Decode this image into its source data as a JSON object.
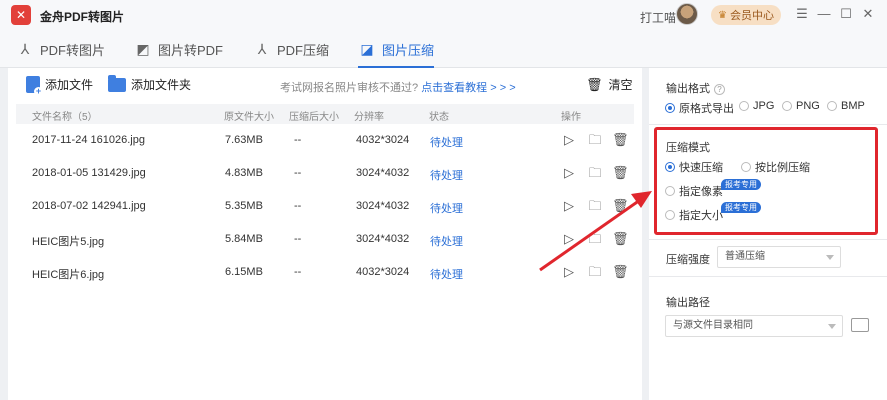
{
  "app": {
    "title": "金舟PDF转图片",
    "user_name": "打工喵",
    "vip_label": "会员中心",
    "accent_color": "#2b6fd6",
    "highlight_color": "#e0262d"
  },
  "tabs": [
    {
      "label": "PDF转图片",
      "icon": "pdf-to-image-icon"
    },
    {
      "label": "图片转PDF",
      "icon": "image-to-pdf-icon"
    },
    {
      "label": "PDF压缩",
      "icon": "pdf-compress-icon"
    },
    {
      "label": "图片压缩",
      "icon": "image-compress-icon",
      "active": true
    }
  ],
  "toolbar": {
    "add_file": "添加文件",
    "add_folder": "添加文件夹",
    "hint_prefix": "考试网报名照片审核不通过?",
    "hint_link": "点击查看教程 > > >",
    "clear": "清空"
  },
  "table": {
    "headers": [
      "文件名称（5）",
      "原文件大小",
      "压缩后大小",
      "分辨率",
      "状态",
      "操作"
    ],
    "rows": [
      {
        "name": "2017-11-24 161026.jpg",
        "size": "7.63MB",
        "compressed": "--",
        "resolution": "4032*3024",
        "status": "待处理"
      },
      {
        "name": "2018-01-05 131429.jpg",
        "size": "4.83MB",
        "compressed": "--",
        "resolution": "3024*4032",
        "status": "待处理"
      },
      {
        "name": "2018-07-02 142941.jpg",
        "size": "5.35MB",
        "compressed": "--",
        "resolution": "3024*4032",
        "status": "待处理"
      },
      {
        "name": "HEIC图片5.jpg",
        "size": "5.84MB",
        "compressed": "--",
        "resolution": "3024*4032",
        "status": "待处理"
      },
      {
        "name": "HEIC图片6.jpg",
        "size": "6.15MB",
        "compressed": "--",
        "resolution": "4032*3024",
        "status": "待处理"
      }
    ]
  },
  "settings": {
    "output_format": {
      "title": "输出格式",
      "options": [
        "原格式导出",
        "JPG",
        "PNG",
        "BMP"
      ],
      "selected": "原格式导出"
    },
    "compress_mode": {
      "title": "压缩模式",
      "options": [
        "快速压缩",
        "按比例压缩",
        "指定像素",
        "指定大小"
      ],
      "selected": "快速压缩",
      "badge": "报考专用"
    },
    "compress_strength": {
      "label": "压缩强度",
      "value": "普通压缩"
    },
    "output_path": {
      "title": "输出路径",
      "value": "与源文件目录相同"
    }
  }
}
